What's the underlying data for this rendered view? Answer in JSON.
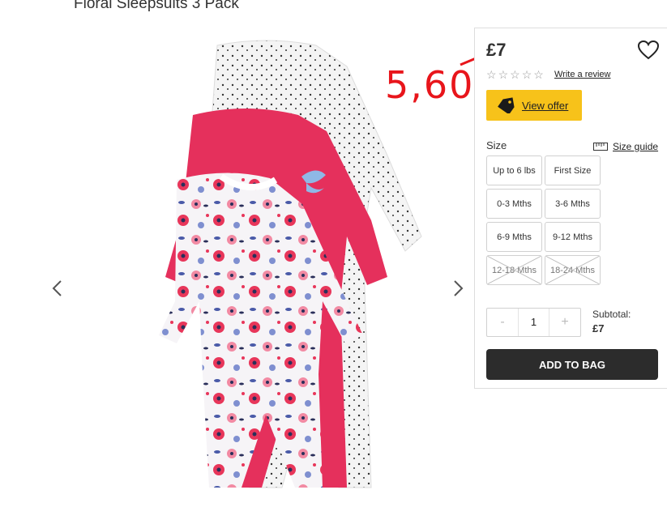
{
  "product": {
    "title": "Floral Sleepsuits 3 Pack",
    "price": "£7",
    "annotation_price": "5,60"
  },
  "rating": {
    "stars_filled": 0,
    "stars_total": 5,
    "write_review_label": "Write a review"
  },
  "offer": {
    "label": "View offer"
  },
  "sizes": {
    "label": "Size",
    "guide_label": "Size guide",
    "options": [
      {
        "label": "Up to 6 lbs",
        "available": true
      },
      {
        "label": "First Size",
        "available": true
      },
      {
        "label": "0-3 Mths",
        "available": true
      },
      {
        "label": "3-6 Mths",
        "available": true
      },
      {
        "label": "6-9 Mths",
        "available": true
      },
      {
        "label": "9-12 Mths",
        "available": true
      },
      {
        "label": "12-18 Mths",
        "available": false
      },
      {
        "label": "18-24 Mths",
        "available": false
      }
    ]
  },
  "quantity": {
    "minus": "-",
    "value": "1",
    "plus": "+"
  },
  "subtotal": {
    "label": "Subtotal:",
    "value": "£7"
  },
  "cart": {
    "add_label": "ADD TO BAG"
  },
  "colors": {
    "accent_yellow": "#f7c21a",
    "annotation_red": "#e8151b",
    "button_dark": "#2c2c2c"
  },
  "icons": [
    "chevron-left-icon",
    "chevron-right-icon",
    "heart-icon",
    "star-icon",
    "tag-icon",
    "ruler-icon"
  ]
}
